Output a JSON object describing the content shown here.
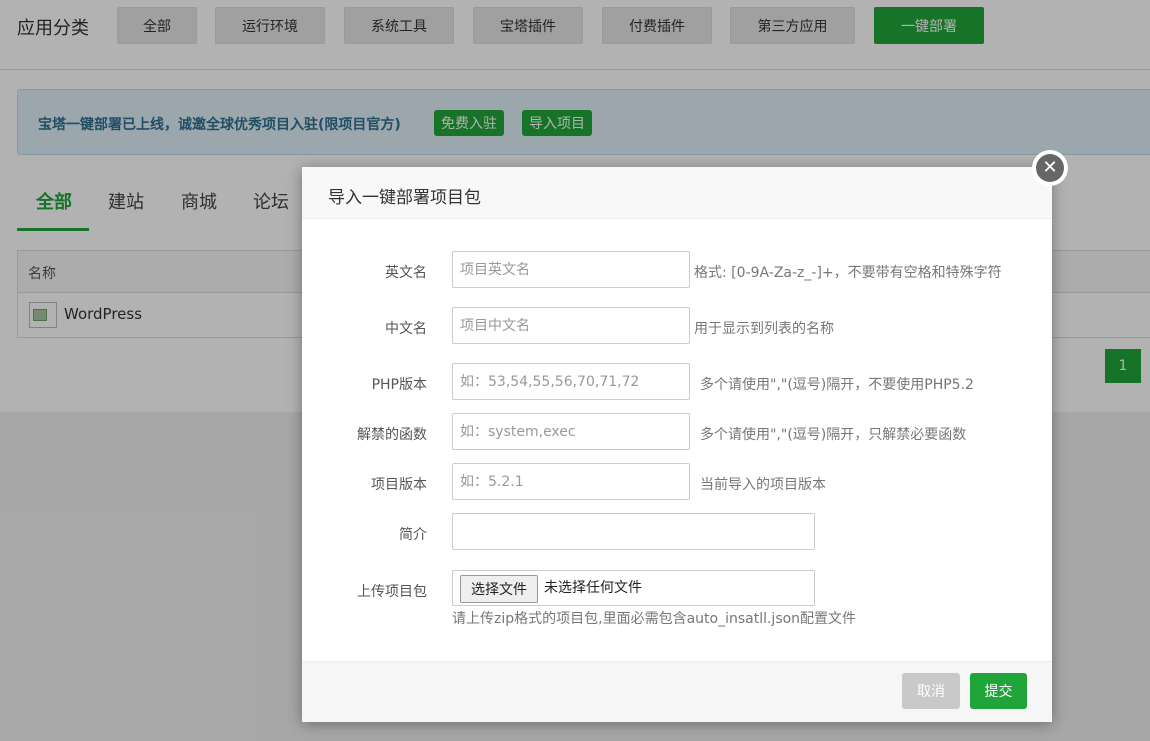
{
  "header": {
    "title": "应用分类",
    "categories": [
      "全部",
      "运行环境",
      "系统工具",
      "宝塔插件",
      "付费插件",
      "第三方应用",
      "一键部署"
    ],
    "active_category": "一键部署"
  },
  "notice": {
    "text": "宝塔一键部署已上线，诚邀全球优秀项目入驻(限项目官方)",
    "join_label": "免费入驻",
    "import_label": "导入项目"
  },
  "tabs": [
    "全部",
    "建站",
    "商城",
    "论坛"
  ],
  "table": {
    "column_name": "名称",
    "rows": [
      {
        "name": "WordPress"
      }
    ]
  },
  "pagination": {
    "current": "1"
  },
  "modal": {
    "title": "导入一键部署项目包",
    "close_icon": "close-icon",
    "fields": {
      "en_name": {
        "label": "英文名",
        "placeholder": "项目英文名",
        "hint": "格式: [0-9A-Za-z_-]+，不要带有空格和特殊字符"
      },
      "cn_name": {
        "label": "中文名",
        "placeholder": "项目中文名",
        "hint": "用于显示到列表的名称"
      },
      "php_version": {
        "label": "PHP版本",
        "placeholder": "如：53,54,55,56,70,71,72",
        "hint": "多个请使用\",\"(逗号)隔开，不要使用PHP5.2"
      },
      "unban_functions": {
        "label": "解禁的函数",
        "placeholder": "如：system,exec",
        "hint": "多个请使用\",\"(逗号)隔开，只解禁必要函数"
      },
      "project_version": {
        "label": "项目版本",
        "placeholder": "如：5.2.1",
        "hint": "当前导入的项目版本"
      },
      "intro": {
        "label": "简介",
        "placeholder": ""
      },
      "upload": {
        "label": "上传项目包",
        "button": "选择文件",
        "status": "未选择任何文件",
        "hint": "请上传zip格式的项目包,里面必需包含auto_insatll.json配置文件"
      }
    },
    "cancel_label": "取消",
    "submit_label": "提交"
  },
  "colors": {
    "accent": "#20a53a",
    "notice_bg": "#dff0f8",
    "notice_text": "#31708f"
  }
}
